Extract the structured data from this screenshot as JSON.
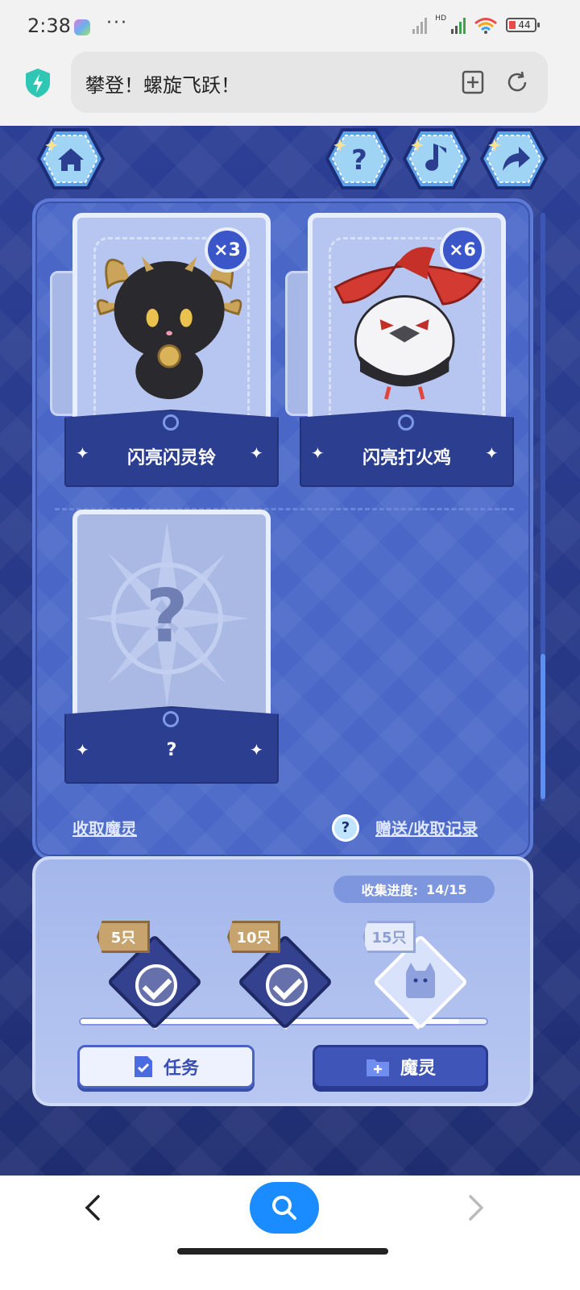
{
  "status_bar": {
    "time": "2:38",
    "dots": "···",
    "hd_label": "HD",
    "battery": "44"
  },
  "browser": {
    "page_title": "攀登！螺旋飞跃！"
  },
  "game": {
    "top_buttons": [
      {
        "name": "home",
        "icon": "home-icon"
      },
      {
        "name": "help",
        "icon": "question-icon"
      },
      {
        "name": "music",
        "icon": "music-note-icon"
      },
      {
        "name": "share",
        "icon": "share-arrow-icon"
      }
    ],
    "cards": [
      {
        "name": "闪亮闪灵铃",
        "count": "×3",
        "creature": "black goat with golden horns"
      },
      {
        "name": "闪亮打火鸡",
        "count": "×6",
        "creature": "white bird with red witch hat"
      },
      {
        "name": "?",
        "count": "",
        "creature": "unknown"
      }
    ],
    "unknown_symbol": "?",
    "links": {
      "receive": "收取魔灵",
      "help_symbol": "?",
      "records": "赠送/收取记录"
    },
    "progress": {
      "label": "收集进度:",
      "value": "14/15",
      "fraction": 0.933
    },
    "milestones": [
      {
        "label": "5只",
        "claimed": true
      },
      {
        "label": "10只",
        "claimed": true
      },
      {
        "label": "15只",
        "claimed": false
      }
    ],
    "buttons": {
      "task": "任务",
      "spirit": "魔灵"
    }
  },
  "colors": {
    "game_bg": "#2d3f95",
    "panel": "#4a67c8",
    "accent": "#1a8cff"
  }
}
